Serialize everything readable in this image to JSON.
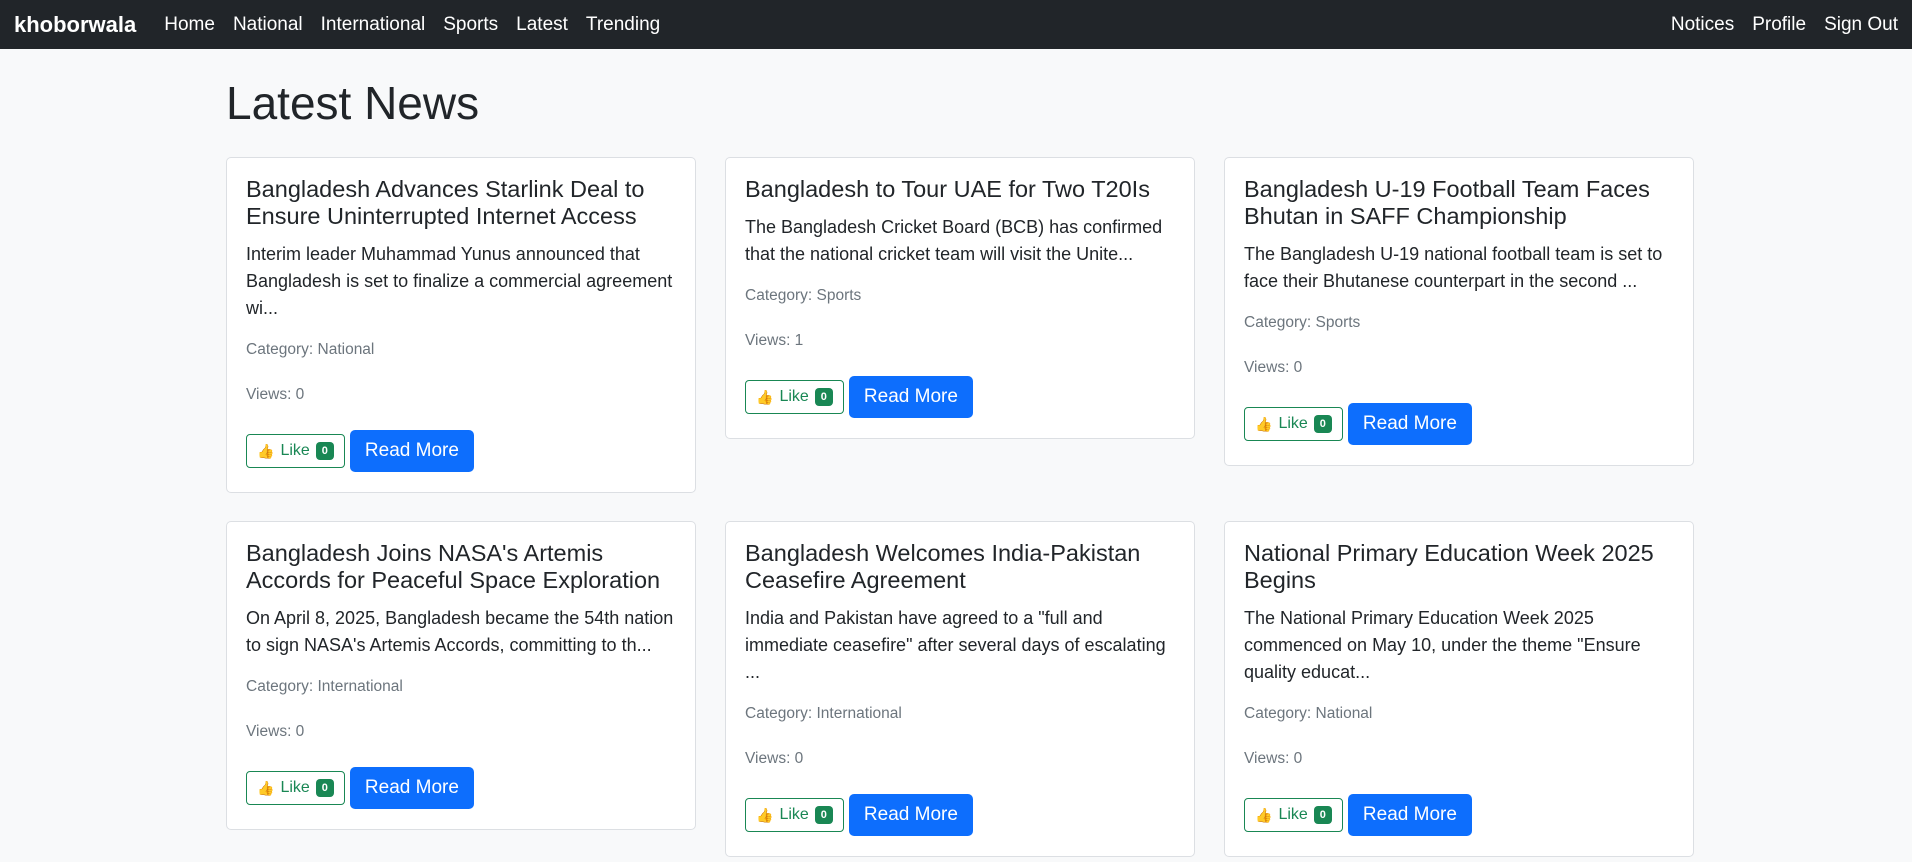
{
  "navbar": {
    "brand": "khoborwala",
    "links": [
      "Home",
      "National",
      "International",
      "Sports",
      "Latest",
      "Trending"
    ],
    "right_links": [
      "Notices",
      "Profile",
      "Sign Out"
    ]
  },
  "page_title": "Latest News",
  "labels": {
    "like": "Like",
    "read_more": "Read More"
  },
  "articles": [
    {
      "title": "Bangladesh Advances Starlink Deal to Ensure Uninterrupted Internet Access",
      "summary": "Interim leader Muhammad Yunus announced that Bangladesh is set to finalize a commercial agreement wi...",
      "category": "Category: National",
      "views": "Views: 0",
      "likes": "0"
    },
    {
      "title": "Bangladesh to Tour UAE for Two T20Is",
      "summary": "The Bangladesh Cricket Board (BCB) has confirmed that the national cricket team will visit the Unite...",
      "category": "Category: Sports",
      "views": "Views: 1",
      "likes": "0"
    },
    {
      "title": "Bangladesh U-19 Football Team Faces Bhutan in SAFF Championship",
      "summary": "The Bangladesh U-19 national football team is set to face their Bhutanese counterpart in the second ...",
      "category": "Category: Sports",
      "views": "Views: 0",
      "likes": "0"
    },
    {
      "title": "Bangladesh Joins NASA's Artemis Accords for Peaceful Space Exploration",
      "summary": "On April 8, 2025, Bangladesh became the 54th nation to sign NASA's Artemis Accords, committing to th...",
      "category": "Category: International",
      "views": "Views: 0",
      "likes": "0"
    },
    {
      "title": "Bangladesh Welcomes India-Pakistan Ceasefire Agreement",
      "summary": "India and Pakistan have agreed to a \"full and immediate ceasefire\" after several days of escalating ...",
      "category": "Category: International",
      "views": "Views: 0",
      "likes": "0"
    },
    {
      "title": "National Primary Education Week 2025 Begins",
      "summary": "The National Primary Education Week 2025 commenced on May 10, under the theme \"Ensure quality educat...",
      "category": "Category: National",
      "views": "Views: 0",
      "likes": "0"
    }
  ]
}
